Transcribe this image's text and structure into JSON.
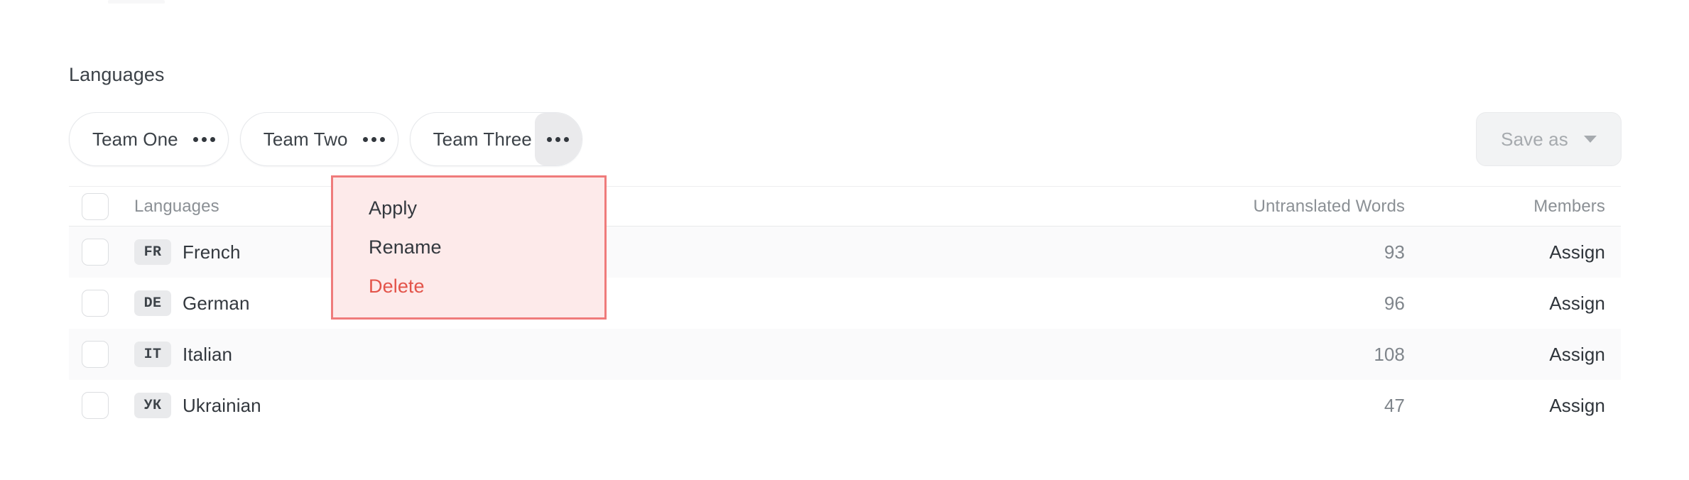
{
  "section": {
    "title": "Languages"
  },
  "teams": [
    {
      "label": "Team One",
      "menu_icon": "ellipsis-icon",
      "menu_active": false
    },
    {
      "label": "Team Two",
      "menu_icon": "ellipsis-icon",
      "menu_active": false
    },
    {
      "label": "Team Three",
      "menu_icon": "ellipsis-icon",
      "menu_active": true
    }
  ],
  "save_as": {
    "label": "Save as",
    "caret_icon": "chevron-down-icon",
    "disabled": true,
    "text_color": "#a6aaae",
    "background": "#f2f3f4"
  },
  "context_menu": {
    "items": [
      {
        "label": "Apply",
        "danger": false
      },
      {
        "label": "Rename",
        "danger": false
      },
      {
        "label": "Delete",
        "danger": true
      }
    ],
    "background": "#fdeaea",
    "border_color": "#ef7b7b",
    "danger_color": "#e3544a"
  },
  "table": {
    "headers": {
      "languages": "Languages",
      "untranslated_words": "Untranslated Words",
      "members": "Members"
    },
    "rows": [
      {
        "code": "FR",
        "language": "French",
        "untranslated_words": "93",
        "members_action": "Assign"
      },
      {
        "code": "DE",
        "language": "German",
        "untranslated_words": "96",
        "members_action": "Assign"
      },
      {
        "code": "IT",
        "language": "Italian",
        "untranslated_words": "108",
        "members_action": "Assign"
      },
      {
        "code": "УК",
        "language": "Ukrainian",
        "untranslated_words": "47",
        "members_action": "Assign"
      }
    ]
  }
}
